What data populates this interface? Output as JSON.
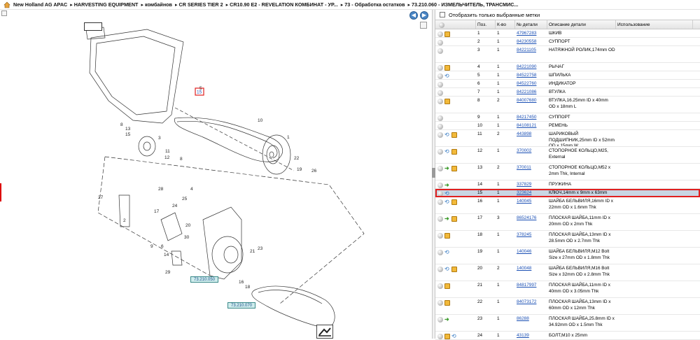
{
  "breadcrumb": [
    "New Holland AG APAC",
    "HARVESTING EQUIPMENT",
    "комбайнов",
    "CR SERIES TIER 2",
    "CR10.90 E2 - REVELATION КОМБИНАТ - УР...",
    "73 - Обработка остатков",
    "73.210.060 - ИЗМЕЛЬЧИТЕЛЬ, ТРАНСМИС..."
  ],
  "filter_label": "Отобразить только выбранные метки",
  "columns": {
    "pos": "Поз.",
    "qty": "К-во",
    "num": "№ детали",
    "desc": "Описание детали",
    "use": "Использование"
  },
  "diagram": {
    "callouts": [
      "1",
      "2",
      "3",
      "4",
      "5",
      "6",
      "7",
      "8",
      "9",
      "10",
      "11",
      "12",
      "13",
      "14",
      "15",
      "16",
      "17",
      "18",
      "19",
      "20",
      "21",
      "22",
      "23",
      "24",
      "25",
      "26",
      "27",
      "28",
      "29",
      "30"
    ],
    "selected_callout": "15",
    "ref_labels": [
      "73.210.050",
      "73.210.070"
    ]
  },
  "parts": [
    {
      "pos": "1",
      "qty": "1",
      "num": "47967283",
      "desc": "ШКИВ",
      "icons": [
        "gray",
        "box"
      ]
    },
    {
      "pos": "2",
      "qty": "1",
      "num": "84230558",
      "desc": "СУППОРТ",
      "icons": [
        "gray"
      ]
    },
    {
      "pos": "3",
      "qty": "1",
      "num": "84221105",
      "desc": "НАТЯЖНОЙ РОЛИК,174mm OD",
      "icons": [
        "gray"
      ]
    },
    {
      "pos": "4",
      "qty": "1",
      "num": "84221090",
      "desc": "РЫЧАГ",
      "icons": [
        "gray",
        "box"
      ]
    },
    {
      "pos": "5",
      "qty": "1",
      "num": "84522758",
      "desc": "ШПИЛЬКА",
      "icons": [
        "gray",
        "blue"
      ]
    },
    {
      "pos": "6",
      "qty": "1",
      "num": "84522760",
      "desc": "ИНДИКАТОР",
      "icons": [
        "gray"
      ]
    },
    {
      "pos": "7",
      "qty": "1",
      "num": "84221086",
      "desc": "ВТУЛКА",
      "icons": [
        "gray"
      ]
    },
    {
      "pos": "8",
      "qty": "2",
      "num": "84007680",
      "desc": "ВТУЛКА,16.25mm ID x 40mm OD x 18mm L",
      "icons": [
        "gray",
        "box"
      ]
    },
    {
      "pos": "9",
      "qty": "1",
      "num": "84217450",
      "desc": "СУППОРТ",
      "icons": [
        "gray"
      ]
    },
    {
      "pos": "10",
      "qty": "1",
      "num": "84108121",
      "desc": "РЕМЕНЬ",
      "icons": [
        "gray"
      ]
    },
    {
      "pos": "11",
      "qty": "2",
      "num": "443898",
      "desc": "ШАРИКОВЫЙ ПОДШИПНИК,25mm ID x 52mm OD x 15mm W",
      "icons": [
        "gray",
        "blue",
        "box"
      ]
    },
    {
      "pos": "12",
      "qty": "1",
      "num": "370002",
      "desc": "СТОПОРНОЕ КОЛЬЦО,M25, External",
      "icons": [
        "gray",
        "blue",
        "box"
      ]
    },
    {
      "pos": "13",
      "qty": "2",
      "num": "370011",
      "desc": "СТОПОРНОЕ КОЛЬЦО,M52 x 2mm Thk, Internal",
      "icons": [
        "gray",
        "green",
        "box"
      ]
    },
    {
      "pos": "14",
      "qty": "1",
      "num": "337829",
      "desc": "ПРУЖИНА",
      "icons": [
        "gray",
        "green"
      ]
    },
    {
      "pos": "15",
      "qty": "1",
      "num": "323624",
      "desc": "КЛЮЧ,14mm x 9mm x 63mm",
      "icons": [
        "gray",
        "blue"
      ],
      "selected": true
    },
    {
      "pos": "16",
      "qty": "1",
      "num": "140045",
      "desc": "ШАЙБА БЕЛЬВИЛЯ,16mm ID x 22mm OD x 1.6mm Thk",
      "icons": [
        "gray",
        "blue",
        "box"
      ]
    },
    {
      "pos": "17",
      "qty": "3",
      "num": "86524176",
      "desc": "ПЛОСКАЯ ШАЙБА,11mm ID x 20mm OD x 2mm Thk",
      "icons": [
        "gray",
        "green",
        "box"
      ]
    },
    {
      "pos": "18",
      "qty": "1",
      "num": "378245",
      "desc": "ПЛОСКАЯ ШАЙБА,13mm ID x 28.5mm OD x 2.7mm Thk",
      "icons": [
        "gray",
        "box"
      ]
    },
    {
      "pos": "19",
      "qty": "1",
      "num": "140046",
      "desc": "ШАЙБА БЕЛЬВИЛЯ,M12 Bolt Size x 27mm OD x 1.8mm Thk",
      "icons": [
        "gray",
        "blue"
      ]
    },
    {
      "pos": "20",
      "qty": "2",
      "num": "140048",
      "desc": "ШАЙБА БЕЛЬВИЛЯ,M16 Bolt Size x 32mm OD x 2.8mm Thk",
      "icons": [
        "gray",
        "blue",
        "box"
      ]
    },
    {
      "pos": "21",
      "qty": "1",
      "num": "84817997",
      "desc": "ПЛОСКАЯ ШАЙБА,11mm ID x 40mm OD x 3.05mm Thk",
      "icons": [
        "gray",
        "box"
      ]
    },
    {
      "pos": "22",
      "qty": "1",
      "num": "84073172",
      "desc": "ПЛОСКАЯ ШАЙБА,13mm ID x 60mm OD x 12mm Thk",
      "icons": [
        "gray",
        "box"
      ]
    },
    {
      "pos": "23",
      "qty": "1",
      "num": "86288",
      "desc": "ПЛОСКАЯ ШАЙБА,25.8mm ID x 34.92mm OD x 1.5mm Thk",
      "icons": [
        "gray",
        "green"
      ]
    },
    {
      "pos": "24",
      "qty": "1",
      "num": "43139",
      "desc": "БОЛТ,M10 x 25mm",
      "icons": [
        "gray",
        "box",
        "blue"
      ]
    }
  ]
}
